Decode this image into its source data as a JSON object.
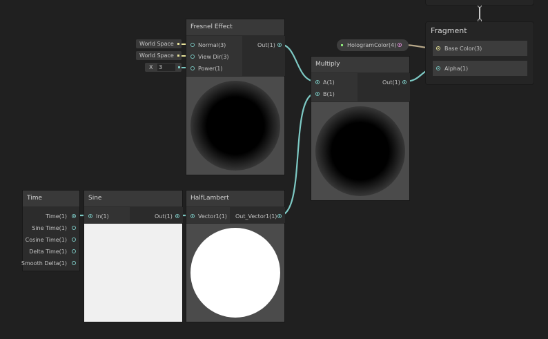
{
  "nodes": {
    "fresnel": {
      "title": "Fresnel Effect",
      "inputs": [
        "Normal(3)",
        "View Dir(3)",
        "Power(1)"
      ],
      "output": "Out(1)",
      "defaults": [
        "World Space",
        "World Space"
      ],
      "power_axis": "X",
      "power_value": "3"
    },
    "multiply": {
      "title": "Multiply",
      "inputs": [
        "A(1)",
        "B(1)"
      ],
      "output": "Out(1)"
    },
    "property": {
      "label": "HologramColor(4)"
    },
    "fragment": {
      "title": "Fragment",
      "inputs": [
        "Base Color(3)",
        "Alpha(1)"
      ]
    },
    "time": {
      "title": "Time",
      "outputs": [
        "Time(1)",
        "Sine Time(1)",
        "Cosine Time(1)",
        "Delta Time(1)",
        "Smooth Delta(1)"
      ]
    },
    "sine": {
      "title": "Sine",
      "input": "In(1)",
      "output": "Out(1)"
    },
    "halflambert": {
      "title": "HalfLambert",
      "input": "Vector1(1)",
      "output": "Out_Vector1(1)"
    }
  },
  "colors": {
    "background": "#202020",
    "float_wire": "#7dc9c4",
    "vector3_wire": "#e8e39a",
    "color_wire": "#e093d8",
    "color_to_vec3_wire": "#b8a98a"
  }
}
